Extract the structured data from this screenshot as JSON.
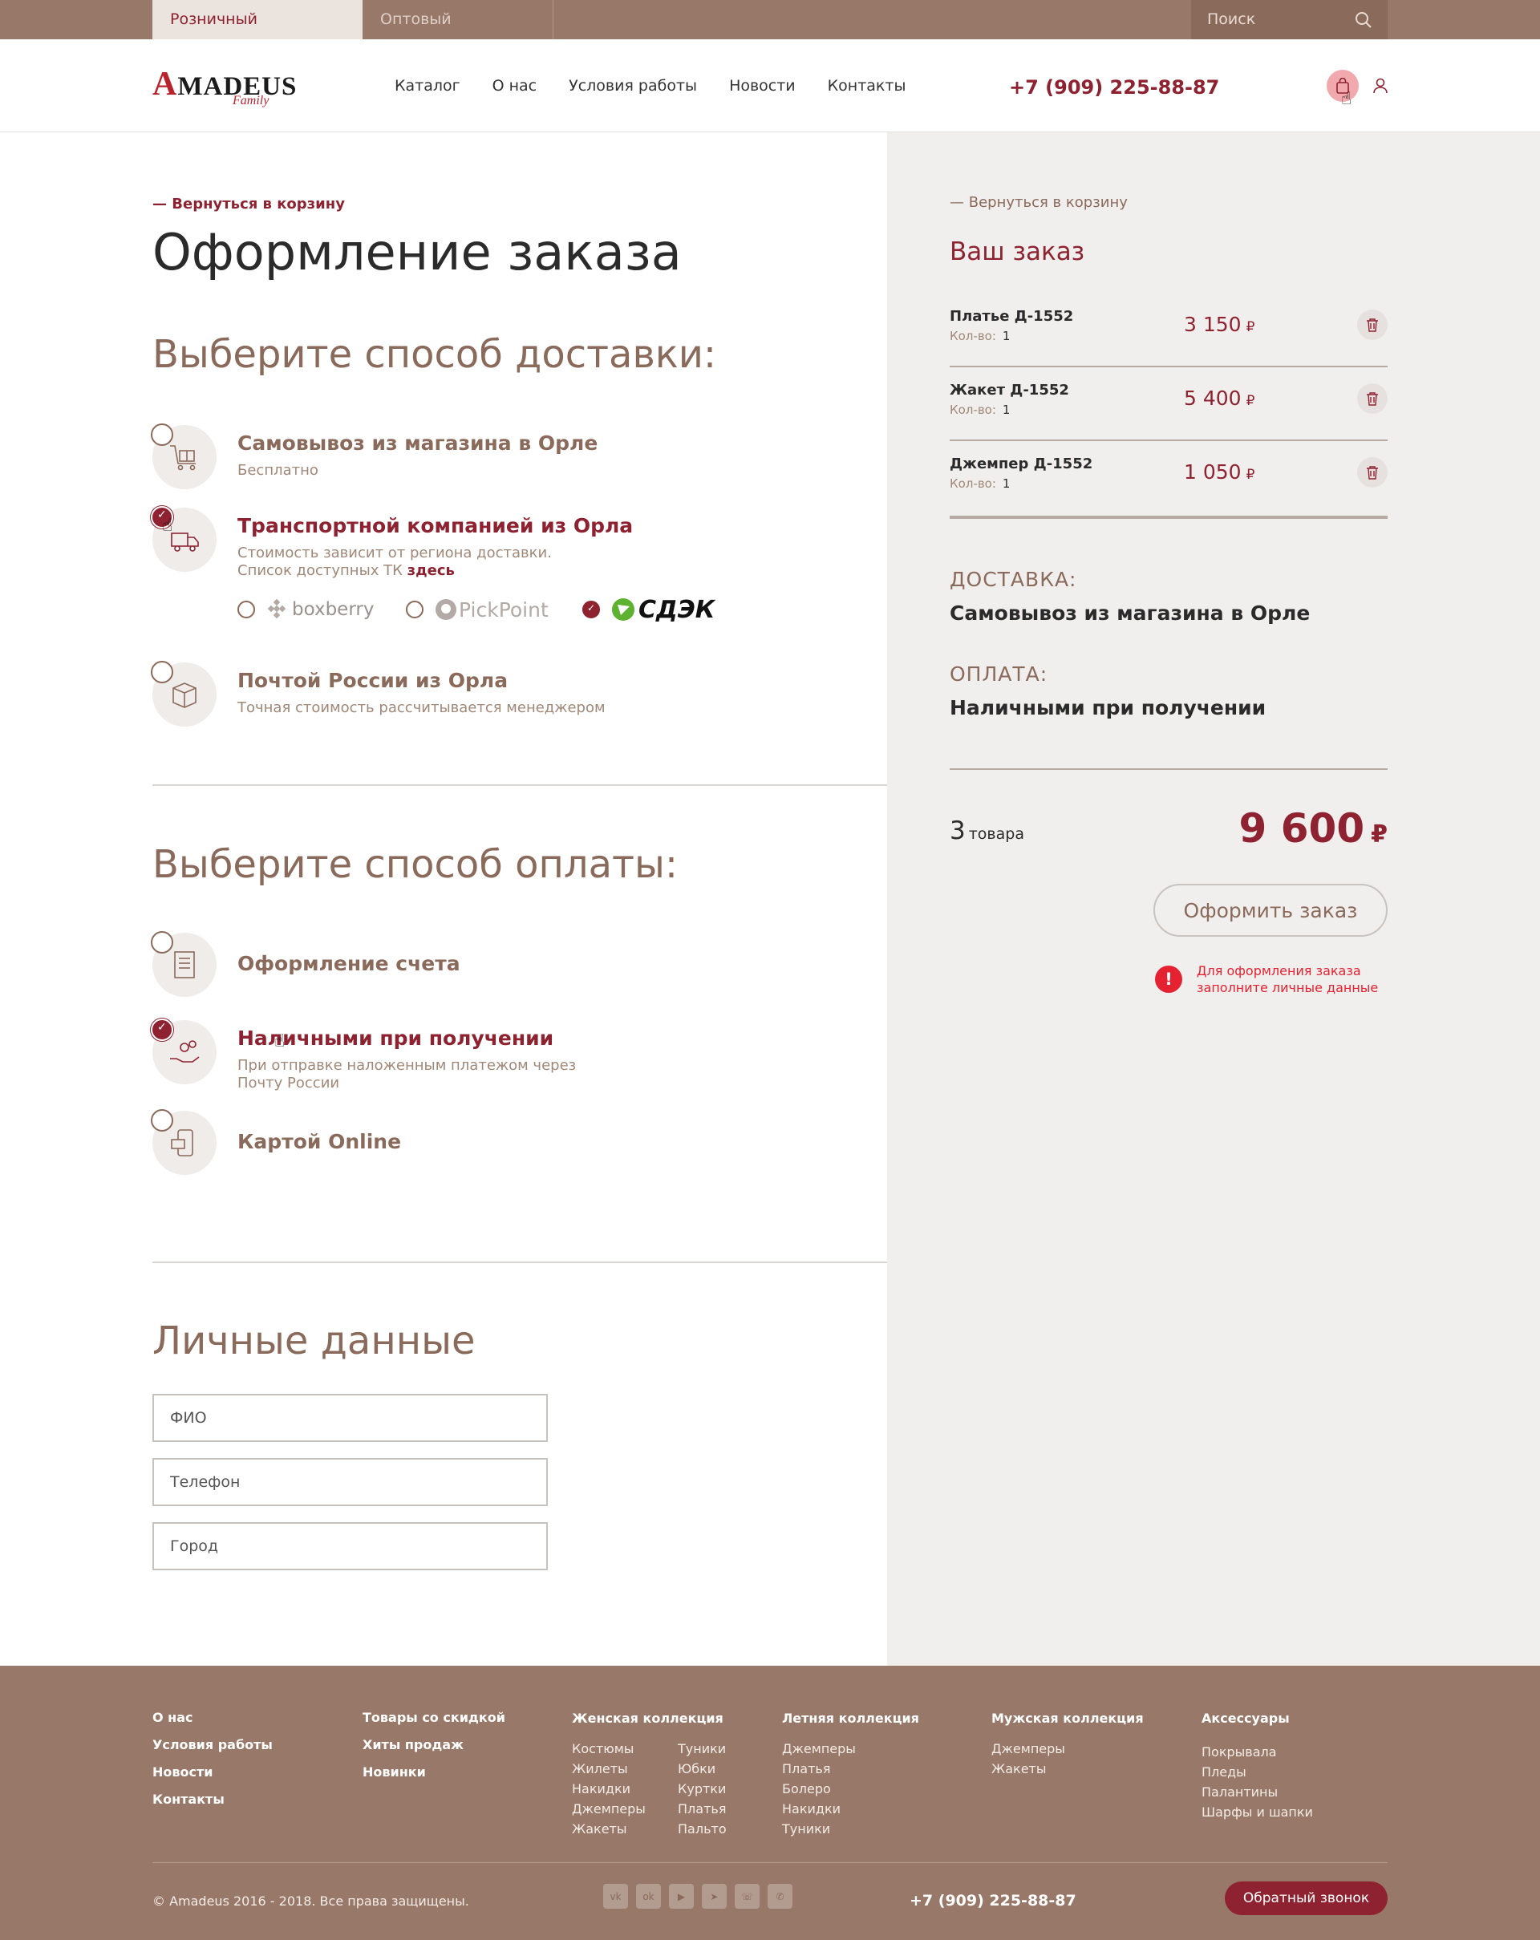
{
  "topbar": {
    "tab_retail": "Розничный покупатель",
    "tab_wholesale": "Оптовый покупатель",
    "search_placeholder": "Поиск"
  },
  "header": {
    "logo_text": "MADEUS",
    "logo_initial": "A",
    "logo_sub": "Family",
    "nav": [
      "Каталог",
      "О нас",
      "Условия работы",
      "Новости",
      "Контакты"
    ],
    "phone": "+7 (909) 225-88-87"
  },
  "checkout": {
    "back_link": "— Вернуться в корзину",
    "title": "Оформление заказа",
    "delivery_heading": "Выберите способ доставки:",
    "delivery_options": [
      {
        "title": "Самовывоз из магазина в Орле",
        "desc": "Бесплатно",
        "selected": false,
        "icon": "gift-cart-icon"
      },
      {
        "title": "Транспортной компанией из Орла",
        "desc1": "Стоимость зависит от региона доставки.",
        "desc2": "Список доступных ТК ",
        "link": "здесь",
        "selected": true,
        "icon": "truck-icon"
      },
      {
        "title": "Почтой России из Орла",
        "desc": "Точная стоимость рассчитывается менеджером",
        "selected": false,
        "icon": "parcel-box-icon"
      }
    ],
    "carriers": [
      {
        "name": "boxberry",
        "selected": false
      },
      {
        "name": "PickPoint",
        "selected": false
      },
      {
        "name": "СДЭК",
        "selected": true
      }
    ],
    "payment_heading": "Выберите способ оплаты:",
    "payment_options": [
      {
        "title": "Оформление счета",
        "selected": false,
        "icon": "invoice-icon"
      },
      {
        "title": "Наличными при получении",
        "desc1": "При отправке наложенным платежом через",
        "desc2": "Почту России",
        "selected": true,
        "icon": "cash-hand-icon"
      },
      {
        "title": "Картой Online",
        "selected": false,
        "icon": "card-phone-icon"
      }
    ],
    "personal_heading": "Личные данные",
    "fields": [
      {
        "placeholder": "ФИО",
        "value": ""
      },
      {
        "placeholder": "Телефон",
        "value": ""
      },
      {
        "placeholder": "Город",
        "value": ""
      }
    ]
  },
  "order": {
    "back_link": "— Вернуться в корзину",
    "title": "Ваш заказ",
    "qty_label": "Кол-во:",
    "currency": "₽",
    "items": [
      {
        "name": "Платье Д-1552",
        "qty": "1",
        "price": "3 150"
      },
      {
        "name": "Жакет Д-1552",
        "qty": "1",
        "price": "5 400"
      },
      {
        "name": "Джемпер Д-1552",
        "qty": "1",
        "price": "1 050"
      }
    ],
    "delivery_label": "ДОСТАВКА:",
    "delivery_value": "Самовывоз из магазина в Орле",
    "payment_label": "ОПЛАТА:",
    "payment_value": "Наличными при получении",
    "count": "3",
    "count_word": "товара",
    "total": "9 600",
    "checkout_button": "Оформить заказ",
    "warning_line1": "Для оформления заказа",
    "warning_line2": "заполните личные данные"
  },
  "footer": {
    "col1": [
      "О нас",
      "Условия работы",
      "Новости",
      "Контакты"
    ],
    "col2": [
      "Товары со скидкой",
      "Хиты продаж",
      "Новинки"
    ],
    "women": {
      "title": "Женская коллекция",
      "a": [
        "Костюмы",
        "Жилеты",
        "Накидки",
        "Джемперы",
        "Жакеты"
      ],
      "b": [
        "Туники",
        "Юбки",
        "Куртки",
        "Платья",
        "Пальто"
      ]
    },
    "summer": {
      "title": "Летняя коллекция",
      "items": [
        "Джемперы",
        "Платья",
        "Болеро",
        "Накидки",
        "Туники"
      ]
    },
    "men": {
      "title": "Мужская коллекция",
      "items": [
        "Джемперы",
        "Жакеты"
      ]
    },
    "acc": {
      "title": "Аксессуары",
      "items": [
        "Покрывала",
        "Пледы",
        "Палантины",
        "Шарфы и шапки"
      ]
    },
    "copyright": "© Amadeus 2016 - 2018. Все права защищены.",
    "social": [
      "vk-icon",
      "odnoklassniki-icon",
      "youtube-icon",
      "telegram-icon",
      "viber-icon",
      "whatsapp-icon"
    ],
    "phone": "+7 (909) 225-88-87",
    "callback": "Обратный звонок"
  }
}
